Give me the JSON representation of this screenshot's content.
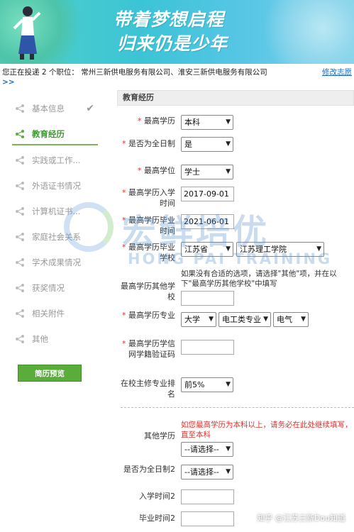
{
  "banner": {
    "line1": "带着梦想启程",
    "line2": "归来仍是少年"
  },
  "positions": {
    "text": "您正在投递 2 个职位： 常州三新供电服务有限公司、淮安三新供电服务有限公司",
    "change_link": "修改志愿",
    "more": ">>"
  },
  "sidebar": {
    "items": [
      {
        "label": "基本信息",
        "done": "✔"
      },
      {
        "label": "教育经历"
      },
      {
        "label": "实践或工作..."
      },
      {
        "label": "外语证书情况"
      },
      {
        "label": "计算机证书..."
      },
      {
        "label": "家庭社会关系"
      },
      {
        "label": "学术成果情况"
      },
      {
        "label": "获奖情况"
      },
      {
        "label": "相关附件"
      },
      {
        "label": "其他"
      }
    ],
    "preview_button": "简历预览"
  },
  "watermark": {
    "cn": "宏鲜培优",
    "en": "HONG PAI TRAINING"
  },
  "form": {
    "section_title": "教育经历",
    "required_mark": "*",
    "fields": {
      "highest_degree_level": {
        "label": "最高学历",
        "value": "本科"
      },
      "full_time": {
        "label": "是否为全日制",
        "value": "是"
      },
      "highest_degree": {
        "label": "最高学位",
        "value": "学士"
      },
      "enroll_date": {
        "label": "最高学历入学时间",
        "value": "2017-09-01"
      },
      "grad_date": {
        "label": "最高学历毕业时间",
        "value": "2021-06-01"
      },
      "school": {
        "label": "最高学历毕业学校",
        "province": "江苏省",
        "school": "江苏理工学院"
      },
      "other_school": {
        "label": "最高学历其他学校",
        "hint": "如果没有合适的选项，请选择\"其他\"项，并在以下\"最高学历其他学校\"中填写",
        "value": ""
      },
      "major": {
        "label": "最高学历专业",
        "v1": "大学",
        "v2": "电工类专业",
        "v3": "电气"
      },
      "verify_code": {
        "label": "最高学历学信网学籍验证码",
        "value": ""
      },
      "rank": {
        "label": "在校主修专业排名",
        "value": "前5%"
      },
      "other_degree": {
        "label": "其他学历",
        "tip": "如您最高学历为本科以上，请务必在此处继续填写，直至本科",
        "value": "--请选择--"
      },
      "full_time2": {
        "label": "是否为全日制2",
        "value": "--请选择--"
      },
      "enroll_date2": {
        "label": "入学时间2",
        "value": ""
      },
      "grad_date2": {
        "label": "毕业时间2",
        "value": ""
      }
    }
  },
  "footer": {
    "zhihu": "知乎 @江苏三新Dou知道"
  },
  "colors": {
    "accent_green": "#5aad3a",
    "required_red": "#e4302b",
    "link_blue": "#1a66c0"
  }
}
